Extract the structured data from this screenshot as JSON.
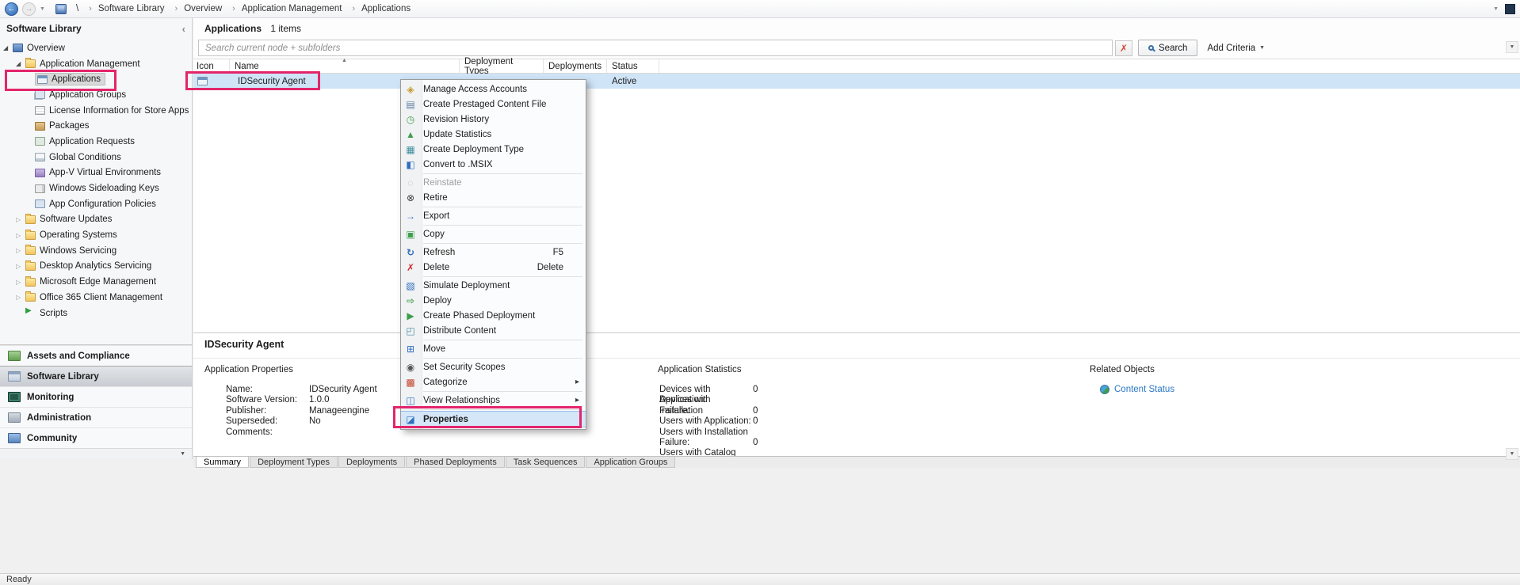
{
  "annotations": {
    "highlight_color": "#e3256b"
  },
  "topbar": {
    "breadcrumb_root": "\\",
    "breadcrumb": [
      "Software Library",
      "Overview",
      "Application Management",
      "Applications"
    ]
  },
  "sidebar": {
    "title": "Software Library",
    "tree": [
      {
        "label": "Overview",
        "icon": "overview-icon"
      },
      {
        "label": "Application Management",
        "icon": "app-management-folder-icon"
      },
      {
        "label": "Applications",
        "icon": "applications-icon"
      },
      {
        "label": "Application Groups",
        "icon": "application-groups-icon"
      },
      {
        "label": "License Information for Store Apps",
        "icon": "license-information-icon"
      },
      {
        "label": "Packages",
        "icon": "packages-icon"
      },
      {
        "label": "Application Requests",
        "icon": "application-requests-icon"
      },
      {
        "label": "Global Conditions",
        "icon": "global-conditions-icon"
      },
      {
        "label": "App-V Virtual Environments",
        "icon": "appv-environments-icon"
      },
      {
        "label": "Windows Sideloading Keys",
        "icon": "sideloading-keys-icon"
      },
      {
        "label": "App Configuration Policies",
        "icon": "app-config-policies-icon"
      },
      {
        "label": "Software Updates",
        "icon": "folder-icon"
      },
      {
        "label": "Operating Systems",
        "icon": "folder-icon"
      },
      {
        "label": "Windows Servicing",
        "icon": "folder-icon"
      },
      {
        "label": "Desktop Analytics Servicing",
        "icon": "folder-icon"
      },
      {
        "label": "Microsoft Edge Management",
        "icon": "folder-icon"
      },
      {
        "label": "Office 365 Client Management",
        "icon": "folder-icon"
      },
      {
        "label": "Scripts",
        "icon": "scripts-icon"
      }
    ],
    "nav": [
      {
        "label": "Assets and Compliance",
        "icon": "assets-and-compliance-icon"
      },
      {
        "label": "Software Library",
        "icon": "software-library-icon"
      },
      {
        "label": "Monitoring",
        "icon": "monitoring-icon"
      },
      {
        "label": "Administration",
        "icon": "administration-icon"
      },
      {
        "label": "Community",
        "icon": "community-icon"
      }
    ]
  },
  "main": {
    "title": "Applications",
    "items_count": "1 items",
    "search": {
      "placeholder": "Search current node + subfolders",
      "search_button": "Search",
      "add_criteria": "Add Criteria"
    },
    "table": {
      "columns": [
        "Icon",
        "Name",
        "Deployment Types",
        "Deployments",
        "Status"
      ],
      "row": {
        "icon": "application-icon",
        "name": "IDSecurity Agent",
        "status": "Active"
      }
    }
  },
  "context_menu": {
    "items": [
      {
        "label": "Manage Access Accounts",
        "icon": "manage-access-accounts-icon"
      },
      {
        "label": "Create Prestaged Content File",
        "icon": "create-prestaged-content-file-icon"
      },
      {
        "label": "Revision History",
        "icon": "revision-history-icon"
      },
      {
        "label": "Update Statistics",
        "icon": "update-statistics-icon"
      },
      {
        "label": "Create Deployment Type",
        "icon": "create-deployment-type-icon"
      },
      {
        "label": "Convert to .MSIX",
        "icon": "convert-to-msix-icon"
      },
      {
        "label": "Reinstate",
        "icon": "reinstate-icon"
      },
      {
        "label": "Retire",
        "icon": "retire-icon"
      },
      {
        "label": "Export",
        "icon": "export-icon"
      },
      {
        "label": "Copy",
        "icon": "copy-icon"
      },
      {
        "label": "Refresh",
        "shortcut": "F5",
        "icon": "refresh-icon"
      },
      {
        "label": "Delete",
        "shortcut": "Delete",
        "icon": "delete-icon"
      },
      {
        "label": "Simulate Deployment",
        "icon": "simulate-deployment-icon"
      },
      {
        "label": "Deploy",
        "icon": "deploy-icon"
      },
      {
        "label": "Create Phased Deployment",
        "icon": "create-phased-deployment-icon"
      },
      {
        "label": "Distribute Content",
        "icon": "distribute-content-icon"
      },
      {
        "label": "Move",
        "icon": "move-icon"
      },
      {
        "label": "Set Security Scopes",
        "icon": "set-security-scopes-icon"
      },
      {
        "label": "Categorize",
        "icon": "categorize-icon"
      },
      {
        "label": "View Relationships",
        "icon": "view-relationships-icon"
      },
      {
        "label": "Properties",
        "icon": "properties-icon"
      }
    ]
  },
  "details": {
    "title": "IDSecurity Agent",
    "properties_header": "Application Properties",
    "properties": [
      {
        "label": "Name:",
        "value": "IDSecurity Agent"
      },
      {
        "label": "Software Version:",
        "value": "1.0.0"
      },
      {
        "label": "Publisher:",
        "value": "Manageengine"
      },
      {
        "label": "Superseded:",
        "value": "No"
      },
      {
        "label": "Comments:",
        "value": ""
      }
    ],
    "statistics_header": "Application Statistics",
    "statistics": [
      {
        "label": "Devices with Application:",
        "value": "0"
      },
      {
        "label": "Devices with Installation",
        "value": ""
      },
      {
        "label": "Failure:",
        "value": "0"
      },
      {
        "label": "Users with Application:",
        "value": "0"
      },
      {
        "label": "Users with Installation",
        "value": ""
      },
      {
        "label": "Failure:",
        "value": "0"
      },
      {
        "label": "Users with Catalog",
        "value": ""
      }
    ],
    "related_header": "Related Objects",
    "related_icon": "content-status-icon",
    "related_link": "Content Status"
  },
  "tabs": [
    {
      "label": "Summary"
    },
    {
      "label": "Deployment Types"
    },
    {
      "label": "Deployments"
    },
    {
      "label": "Phased Deployments"
    },
    {
      "label": "Task Sequences"
    },
    {
      "label": "Application Groups"
    }
  ],
  "statusbar": {
    "text": "Ready"
  }
}
